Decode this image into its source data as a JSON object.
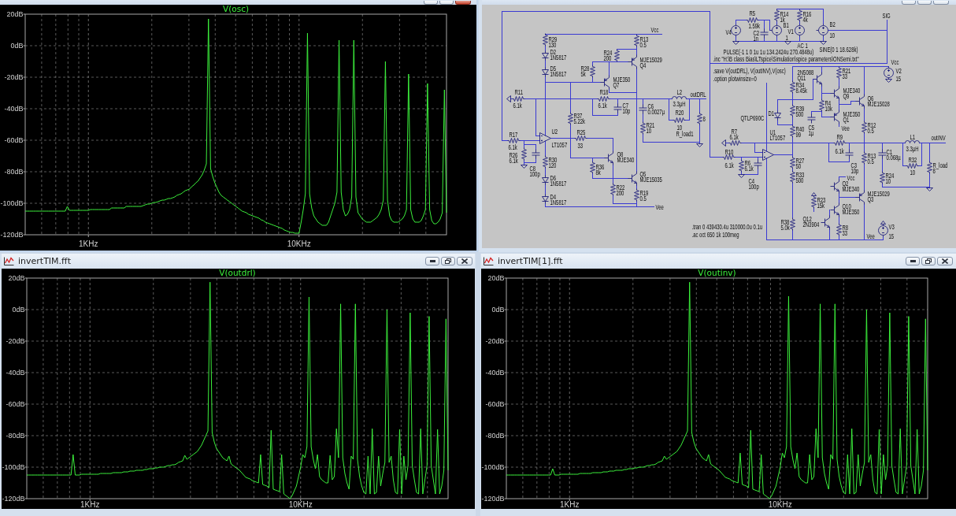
{
  "windows": [
    {
      "kind": "plot",
      "active": true,
      "chart_data": {
        "type": "line",
        "title": "V(osc)",
        "grid": true,
        "categories": [
          null,
          null,
          null,
          null,
          null,
          null,
          null,
          null,
          null,
          null,
          null,
          null,
          null,
          null,
          null,
          null,
          null,
          null,
          null,
          null,
          null,
          null,
          null,
          null,
          null,
          null,
          null,
          null,
          null,
          null,
          "1KHz",
          null,
          null,
          null,
          null,
          null,
          null,
          null,
          null,
          null,
          null,
          null,
          null,
          null,
          null,
          null,
          null,
          null,
          null,
          null,
          null,
          null,
          null,
          null,
          null,
          null,
          null,
          null,
          null,
          null,
          null,
          null,
          null,
          null,
          null,
          null,
          null,
          null,
          null,
          null,
          null,
          null,
          null,
          null,
          null,
          null,
          null,
          null,
          null,
          null,
          null,
          null,
          null,
          null,
          null,
          null,
          null,
          null,
          null,
          null,
          null,
          null,
          null,
          null,
          null,
          null,
          null,
          null,
          null,
          null,
          null,
          null,
          null,
          null,
          null,
          null,
          null,
          null,
          null,
          null,
          null,
          null,
          null,
          null,
          null,
          null,
          null,
          null,
          null,
          null,
          null,
          null,
          null,
          null,
          null,
          null,
          null,
          null,
          null,
          null,
          "10KHz",
          null,
          null,
          null,
          null,
          null,
          null,
          null,
          null,
          null,
          null,
          null,
          null,
          null,
          null,
          null,
          null,
          null,
          null,
          null,
          null,
          null,
          null,
          null,
          null,
          null,
          null,
          null,
          null,
          null,
          null,
          null,
          null,
          null,
          null,
          null,
          null,
          null,
          null,
          null,
          null,
          null,
          null,
          null,
          null,
          null,
          null,
          null,
          null,
          null,
          null,
          null,
          null,
          null,
          null,
          null,
          null,
          null,
          null,
          null,
          null,
          null,
          null,
          null,
          null,
          null,
          null,
          null,
          null,
          null,
          null
        ],
        "series": [
          {
            "color": "#3cf03c",
            "values": [
              -105,
              -105,
              -105,
              -105,
              -105,
              -105,
              -105,
              -105,
              -105,
              -105,
              -105,
              -105,
              -105,
              -105,
              -105,
              -105,
              -105,
              -105,
              -105,
              -105,
              -102,
              -104.5,
              -104.5,
              -104.5,
              -104.5,
              -104.5,
              -104.5,
              -104.5,
              -104.5,
              -104.5,
              -104.5,
              -104,
              -104,
              -104,
              -104,
              -104,
              -104,
              -104,
              -104,
              -104,
              -104,
              -103,
              -103,
              -103,
              -103,
              -103,
              -103,
              -103,
              -102,
              -102,
              -102,
              -102,
              -102,
              -102,
              -102,
              -102,
              -101.5,
              -101,
              -100.5,
              -100.5,
              -100,
              -99.5,
              -99.5,
              -99,
              -98.5,
              -98,
              -98,
              -97.5,
              -97,
              -97,
              -96.5,
              -96,
              -95,
              -94.5,
              -94,
              -93,
              -92,
              -91.5,
              -91,
              -89.5,
              -88.5,
              -87,
              -86,
              -84,
              -82,
              -79,
              -75,
              17,
              -78,
              -83,
              -87,
              -90,
              -93,
              -95,
              -96,
              -97,
              -98,
              -99,
              -100,
              -101,
              -102,
              -103,
              -104,
              -105,
              -105.5,
              -106,
              -107,
              -107.5,
              -108,
              -108.5,
              -109,
              -109.5,
              -110.5,
              -111,
              -112,
              -112.5,
              -113,
              -113.5,
              -114,
              -114.5,
              -115,
              -115.5,
              -116,
              -117,
              -117.5,
              -118,
              -118.5,
              -118.5,
              -119,
              -119,
              -119,
              -112,
              -104,
              -94,
              8,
              -94,
              -103,
              -108,
              -110,
              -112,
              -113,
              -114,
              -114,
              -114,
              -112,
              -108,
              -104,
              -100,
              -93,
              3.5,
              -93,
              -104,
              -108,
              -107,
              -104,
              -96,
              3.5,
              -96,
              -106,
              -108,
              -110,
              -111,
              -112,
              -112,
              -112,
              -111,
              -110,
              -109,
              -107,
              -104,
              -98,
              -10,
              -98,
              -108,
              -111,
              -112,
              -112,
              -112,
              -111,
              -110,
              -108,
              -104,
              -18,
              -104,
              -110,
              -112,
              -112,
              -112,
              -111,
              -108,
              -104,
              -24,
              -104,
              -111,
              -113,
              -113,
              -112,
              -110,
              -106,
              -28,
              -106
            ]
          }
        ],
        "ylim": [
          -120,
          20
        ],
        "yticks": [
          {
            "value": 20,
            "label": "20dB"
          },
          {
            "value": 0,
            "label": "0dB"
          },
          {
            "value": -20,
            "label": "-20dB"
          },
          {
            "value": -40,
            "label": "-40dB"
          },
          {
            "value": -60,
            "label": "-60dB"
          },
          {
            "value": -80,
            "label": "-80dB"
          },
          {
            "value": -100,
            "label": "-100dB"
          },
          {
            "value": -120,
            "label": "-120dB"
          }
        ]
      }
    },
    {
      "kind": "schematic",
      "active": false,
      "schematic": {
        "components": [
          {
            "kind": "resistor",
            "labels": [
              "R29",
              "130"
            ]
          },
          {
            "kind": "resistor",
            "labels": [
              "R13",
              "0.5"
            ]
          },
          {
            "kind": "diode",
            "labels": [
              "D2",
              "1N5817"
            ]
          },
          {
            "kind": "resistor",
            "labels": [
              "R24",
              "200"
            ]
          },
          {
            "kind": "diode",
            "labels": [
              "D5",
              "1N5817"
            ]
          },
          {
            "kind": "resistor",
            "labels": [
              "R28",
              "5k"
            ]
          },
          {
            "kind": "pnp",
            "labels": [
              "MJE15029",
              "Q4"
            ]
          },
          {
            "kind": "pnp",
            "labels": [
              "MJE350",
              "Q7"
            ]
          },
          {
            "kind": "resistor",
            "labels": [
              "R11",
              "6.1k"
            ]
          },
          {
            "kind": "resistor",
            "labels": [
              "R18",
              "6.1k"
            ]
          },
          {
            "kind": "resistor",
            "labels": [
              "R37",
              "5.22k"
            ]
          },
          {
            "kind": "capacitor",
            "labels": [
              "C7",
              "10p"
            ]
          },
          {
            "kind": "capacitor",
            "labels": [
              "C6",
              "0.0027µ"
            ]
          },
          {
            "kind": "inductor",
            "labels": [
              "L2",
              "3.3µH"
            ]
          },
          {
            "kind": "resistor",
            "labels": [
              "R17",
              "6.1k"
            ]
          },
          {
            "kind": "opamp",
            "labels": [
              "U2",
              "LT1057"
            ]
          },
          {
            "kind": "resistor",
            "labels": [
              "R25",
              "33"
            ]
          },
          {
            "kind": "resistor",
            "labels": [
              "R21",
              "10"
            ]
          },
          {
            "kind": "resistor",
            "labels": [
              "R20",
              "10"
            ]
          },
          {
            "kind": "resistor",
            "labels": [
              "R_load1",
              "8"
            ]
          },
          {
            "kind": "resistor",
            "labels": [
              "R26",
              "6.1k"
            ]
          },
          {
            "kind": "capacitor",
            "labels": [
              "C8",
              "100p"
            ]
          },
          {
            "kind": "resistor",
            "labels": [
              "R30",
              "120"
            ]
          },
          {
            "kind": "npn",
            "labels": [
              "Q8",
              "MJE340"
            ]
          },
          {
            "kind": "diode",
            "labels": [
              "D6",
              "1N5817"
            ]
          },
          {
            "kind": "resistor",
            "labels": [
              "R36",
              "8k"
            ]
          },
          {
            "kind": "npn",
            "labels": [
              "Q5",
              "MJE15035"
            ]
          },
          {
            "kind": "diode",
            "labels": [
              "D4",
              "1N5817"
            ]
          },
          {
            "kind": "resistor",
            "labels": [
              "R22",
              "200"
            ]
          },
          {
            "kind": "resistor",
            "labels": [
              "R19",
              "0.5"
            ]
          },
          {
            "kind": "resistor",
            "labels": [
              "R5",
              "1.59k"
            ]
          },
          {
            "kind": "resistor",
            "labels": [
              "R14",
              "1k"
            ]
          },
          {
            "kind": "resistor",
            "labels": [
              "R16",
              "4k"
            ]
          },
          {
            "kind": "vsource",
            "labels": [
              "V4"
            ]
          },
          {
            "kind": "capacitor",
            "labels": [
              "C2",
              "1n"
            ]
          },
          {
            "kind": "bsource",
            "labels": [
              "B1"
            ]
          },
          {
            "kind": "vsource",
            "labels": [
              "V1"
            ]
          },
          {
            "kind": "bsource",
            "labels": [
              "B2",
              "10"
            ]
          },
          {
            "kind": "npn",
            "labels": [
              "2N5088",
              "Q11"
            ]
          },
          {
            "kind": "resistor",
            "labels": [
              "R21",
              "33"
            ]
          },
          {
            "kind": "vsource",
            "labels": [
              "V2",
              "15"
            ]
          },
          {
            "kind": "resistor",
            "labels": [
              "R34",
              "8.45k"
            ]
          },
          {
            "kind": "npn",
            "labels": [
              "MJE340",
              "Q9"
            ]
          },
          {
            "kind": "diode",
            "labels": [
              "D1",
              "QTLP690C"
            ]
          },
          {
            "kind": "resistor",
            "labels": [
              "R39",
              "500"
            ]
          },
          {
            "kind": "resistor",
            "labels": [
              "R4",
              "10k"
            ]
          },
          {
            "kind": "npn",
            "labels": [
              "Q6",
              "MJE15028"
            ]
          },
          {
            "kind": "pnp",
            "labels": [
              "MJE350",
              "Q1"
            ]
          },
          {
            "kind": "resistor",
            "labels": [
              "R7",
              "6.1k"
            ]
          },
          {
            "kind": "opamp",
            "labels": [
              "U1",
              "LT1057"
            ]
          },
          {
            "kind": "resistor",
            "labels": [
              "R40",
              "99"
            ]
          },
          {
            "kind": "capacitor",
            "labels": [
              "C5",
              "1µ"
            ]
          },
          {
            "kind": "resistor",
            "labels": [
              "R12",
              "0.5"
            ]
          },
          {
            "kind": "resistor",
            "labels": [
              "R10",
              "6.1k"
            ]
          },
          {
            "kind": "resistor",
            "labels": [
              "R9",
              "6.1k"
            ]
          },
          {
            "kind": "resistor",
            "labels": [
              "R6",
              "6.1k"
            ]
          },
          {
            "kind": "resistor",
            "labels": [
              "R27",
              "50"
            ]
          },
          {
            "kind": "capacitor",
            "labels": [
              "C4",
              "100p"
            ]
          },
          {
            "kind": "resistor",
            "labels": [
              "R33",
              "500"
            ]
          },
          {
            "kind": "capacitor",
            "labels": [
              "C3",
              "10p"
            ]
          },
          {
            "kind": "resistor",
            "labels": [
              "R13",
              "0.5"
            ]
          },
          {
            "kind": "capacitor",
            "labels": [
              "C1",
              "0.068µ"
            ]
          },
          {
            "kind": "inductor",
            "labels": [
              "L1",
              "3.3µH"
            ]
          },
          {
            "kind": "npn",
            "labels": [
              "Q2",
              "MJE340"
            ]
          },
          {
            "kind": "resistor",
            "labels": [
              "R24",
              "10"
            ]
          },
          {
            "kind": "resistor",
            "labels": [
              "R32",
              "10"
            ]
          },
          {
            "kind": "resistor",
            "labels": [
              "R_load",
              "8"
            ]
          },
          {
            "kind": "resistor",
            "labels": [
              "R23",
              "15k"
            ]
          },
          {
            "kind": "pnp",
            "labels": [
              "MJE15029",
              "Q3"
            ]
          },
          {
            "kind": "npn",
            "labels": [
              "Q10",
              "MJE350"
            ]
          },
          {
            "kind": "resistor",
            "labels": [
              "R38",
              "5.0k"
            ]
          },
          {
            "kind": "npn",
            "labels": [
              "Q12",
              "2N3904"
            ]
          },
          {
            "kind": "resistor",
            "labels": [
              "R8",
              "33"
            ]
          },
          {
            "kind": "vsource",
            "labels": [
              "V3",
              "15"
            ]
          }
        ],
        "net_labels": [
          "Vcc",
          "outDRL",
          "Vee",
          "SIG",
          "1",
          "AC 1",
          "Vcc",
          "Vee",
          "outINV",
          "Vcc",
          "Vee"
        ],
        "source_values": [
          "PULSE(-1 1 0 1u 1u 134.2424u 270.4848u)",
          "SINE(0 1 18.628k)"
        ],
        "directives": [
          ".inc \"H:\\B class Bias\\LTspice\\Simulation\\spice parameters\\ONSemi.txt\"",
          ".save V(outDRL), V(outINV),V(osc)",
          ".option plotwinsize=0",
          ".tran 0 439430.4u 310000.0u 0.1u",
          ".ac oct 650 1k 100meg"
        ]
      }
    },
    {
      "kind": "plot",
      "title": "invertTIM.fft",
      "active": false,
      "chart_data": {
        "type": "line",
        "title": "V(outdrl)",
        "grid": true,
        "categories": [
          null,
          null,
          null,
          null,
          null,
          null,
          null,
          null,
          null,
          null,
          null,
          null,
          null,
          null,
          null,
          null,
          null,
          null,
          null,
          null,
          null,
          null,
          null,
          null,
          null,
          null,
          null,
          null,
          null,
          null,
          "1KHz",
          null,
          null,
          null,
          null,
          null,
          null,
          null,
          null,
          null,
          null,
          null,
          null,
          null,
          null,
          null,
          null,
          null,
          null,
          null,
          null,
          null,
          null,
          null,
          null,
          null,
          null,
          null,
          null,
          null,
          null,
          null,
          null,
          null,
          null,
          null,
          null,
          null,
          null,
          null,
          null,
          null,
          null,
          null,
          null,
          null,
          null,
          null,
          null,
          null,
          null,
          null,
          null,
          null,
          null,
          null,
          null,
          null,
          null,
          null,
          null,
          null,
          null,
          null,
          null,
          null,
          null,
          null,
          null,
          null,
          null,
          null,
          null,
          null,
          null,
          null,
          null,
          null,
          null,
          null,
          null,
          null,
          null,
          null,
          null,
          null,
          null,
          null,
          null,
          null,
          null,
          null,
          null,
          null,
          null,
          null,
          null,
          null,
          null,
          null,
          "10KHz",
          null,
          null,
          null,
          null,
          null,
          null,
          null,
          null,
          null,
          null,
          null,
          null,
          null,
          null,
          null,
          null,
          null,
          null,
          null,
          null,
          null,
          null,
          null,
          null,
          null,
          null,
          null,
          null,
          null,
          null,
          null,
          null,
          null,
          null,
          null,
          null,
          null,
          null,
          null,
          null,
          null,
          null,
          null,
          null,
          null,
          null,
          null,
          null,
          null,
          null,
          null,
          null,
          null,
          null,
          null,
          null,
          null,
          null,
          null,
          null,
          null,
          null,
          null,
          null,
          null,
          null,
          null,
          null,
          null,
          null
        ],
        "series": [
          {
            "color": "#3cf03c",
            "values": [
              -105,
              -105,
              -105,
              -105,
              -105,
              -105,
              -105,
              -105,
              -105,
              -105,
              -105,
              -105,
              -105,
              -105,
              -105,
              -105,
              -105,
              -105,
              -105,
              -105,
              -105,
              -105,
              -92,
              -105,
              -105,
              -105,
              -104.5,
              -104.5,
              -104.5,
              -104.5,
              -104.5,
              -104.5,
              -104.5,
              -104.5,
              -104.5,
              -104,
              -104,
              -104,
              -104,
              -104,
              -104,
              -103.5,
              -103.5,
              -103.5,
              -103.5,
              -103.5,
              -103,
              -103,
              -103,
              -102.5,
              -102.5,
              -102.5,
              -102,
              -102,
              -102,
              -102,
              -101.5,
              -101.5,
              -101,
              -101,
              -101,
              -100.5,
              -100.5,
              -100,
              -100,
              -100,
              -99.5,
              -99,
              -99,
              -98.5,
              -98.5,
              -98,
              -97,
              -96.5,
              -96,
              -92.5,
              -95,
              -94,
              -93,
              -92,
              -91,
              -90,
              -88,
              -86,
              -83,
              -80,
              -77,
              17.4,
              -78,
              -84,
              -88,
              -90,
              -92,
              -94,
              -95,
              -96,
              -93,
              -98,
              -99,
              -100,
              -101,
              -102,
              -103.5,
              -105,
              -106.5,
              -107,
              -107.5,
              -108.5,
              -109,
              -109.5,
              -110,
              -92,
              -111,
              -111.5,
              -112,
              -113,
              -76.6,
              -114,
              -114.5,
              -115,
              -115.5,
              -92,
              -117,
              -118,
              -119,
              -120,
              -118,
              -115,
              -112,
              -106,
              -100,
              -92,
              -94,
              -87,
              8,
              -87,
              -95,
              -101,
              -92,
              -106,
              -108,
              -109,
              -110,
              -110,
              -92.5,
              -108,
              -106,
              -75.6,
              -94,
              3.6,
              -94,
              -104,
              -110,
              -114,
              -93,
              -95,
              3.6,
              -95,
              -106,
              -112,
              -116,
              -117,
              -93,
              -117,
              -75.6,
              -117,
              -116,
              -93,
              -112,
              -104,
              -97,
              0,
              -97,
              -93,
              -108,
              -116,
              -117,
              -76,
              -117,
              -93,
              -108,
              -99,
              -2,
              -99,
              -108,
              -116,
              -117,
              -75.6,
              -117,
              -108,
              -99,
              -4.3,
              -99,
              -108,
              -117,
              -76,
              -117,
              -112,
              -102,
              -5.9,
              -102
            ]
          }
        ],
        "ylim": [
          -120,
          20
        ],
        "yticks": [
          {
            "value": 20,
            "label": "20dB"
          },
          {
            "value": 0,
            "label": "0dB"
          },
          {
            "value": -20,
            "label": "-20dB"
          },
          {
            "value": -40,
            "label": "-40dB"
          },
          {
            "value": -60,
            "label": "-60dB"
          },
          {
            "value": -80,
            "label": "-80dB"
          },
          {
            "value": -100,
            "label": "-100dB"
          },
          {
            "value": -120,
            "label": "-120dB"
          }
        ]
      }
    },
    {
      "kind": "plot",
      "title": "invertTIM[1].fft",
      "active": false,
      "chart_data": {
        "type": "line",
        "title": "V(outinv)",
        "grid": true,
        "categories": [
          null,
          null,
          null,
          null,
          null,
          null,
          null,
          null,
          null,
          null,
          null,
          null,
          null,
          null,
          null,
          null,
          null,
          null,
          null,
          null,
          null,
          null,
          null,
          null,
          null,
          null,
          null,
          null,
          null,
          null,
          "1KHz",
          null,
          null,
          null,
          null,
          null,
          null,
          null,
          null,
          null,
          null,
          null,
          null,
          null,
          null,
          null,
          null,
          null,
          null,
          null,
          null,
          null,
          null,
          null,
          null,
          null,
          null,
          null,
          null,
          null,
          null,
          null,
          null,
          null,
          null,
          null,
          null,
          null,
          null,
          null,
          null,
          null,
          null,
          null,
          null,
          null,
          null,
          null,
          null,
          null,
          null,
          null,
          null,
          null,
          null,
          null,
          null,
          null,
          null,
          null,
          null,
          null,
          null,
          null,
          null,
          null,
          null,
          null,
          null,
          null,
          null,
          null,
          null,
          null,
          null,
          null,
          null,
          null,
          null,
          null,
          null,
          null,
          null,
          null,
          null,
          null,
          null,
          null,
          null,
          null,
          null,
          null,
          null,
          null,
          null,
          null,
          null,
          null,
          null,
          null,
          "10KHz",
          null,
          null,
          null,
          null,
          null,
          null,
          null,
          null,
          null,
          null,
          null,
          null,
          null,
          null,
          null,
          null,
          null,
          null,
          null,
          null,
          null,
          null,
          null,
          null,
          null,
          null,
          null,
          null,
          null,
          null,
          null,
          null,
          null,
          null,
          null,
          null,
          null,
          null,
          null,
          null,
          null,
          null,
          null,
          null,
          null,
          null,
          null,
          null,
          null,
          null,
          null,
          null,
          null,
          null,
          null,
          null,
          null,
          null,
          null,
          null,
          null,
          null,
          null,
          null,
          null,
          null,
          null,
          null,
          null,
          null
        ],
        "series": [
          {
            "color": "#3cf03c",
            "values": [
              -105,
              -105,
              -105,
              -105,
              -105,
              -105,
              -105,
              -105,
              -105,
              -105,
              -105,
              -105,
              -105,
              -105,
              -105,
              -105,
              -105,
              -105,
              -105,
              -105,
              -105,
              -105,
              -101,
              -105,
              -105,
              -105,
              -104.5,
              -104.5,
              -104.5,
              -104.5,
              -104.5,
              -104.5,
              -104.5,
              -104.5,
              -104.5,
              -104,
              -104,
              -104,
              -104,
              -104,
              -104,
              -103.5,
              -103.5,
              -103.5,
              -103.5,
              -103.5,
              -103,
              -103,
              -103,
              -102.5,
              -102.5,
              -102.5,
              -102,
              -102,
              -102,
              -102,
              -101.5,
              -101.5,
              -101,
              -101,
              -101,
              -100.5,
              -100.5,
              -100,
              -100,
              -100,
              -99.5,
              -99,
              -99,
              -98.5,
              -98.5,
              -98,
              -97,
              -96.5,
              -96,
              -93,
              -95,
              -94,
              -93,
              -92,
              -91,
              -90,
              -88,
              -86,
              -83,
              -80,
              -77,
              17.4,
              -78,
              -84,
              -88,
              -90,
              -92,
              -94,
              -95,
              -96,
              -92,
              -98,
              -99,
              -100,
              -101,
              -102,
              -103.5,
              -105,
              -106.5,
              -107,
              -107.5,
              -108.5,
              -109,
              -109.5,
              -110,
              -91,
              -111,
              -111.5,
              -112,
              -113,
              -76.6,
              -114,
              -114.5,
              -115,
              -115.5,
              -92,
              -117,
              -118,
              -119,
              -120,
              -118,
              -115,
              -112,
              -106,
              -100,
              -91,
              -94,
              -87,
              8.5,
              -87,
              -95,
              -101,
              -91,
              -106,
              -108,
              -109,
              -110,
              -110,
              -92,
              -108,
              -106,
              -75.6,
              -94,
              3.6,
              -94,
              -104,
              -110,
              -114,
              -92,
              -95,
              3.6,
              -95,
              -106,
              -112,
              -116,
              -117,
              -92,
              -117,
              -75.6,
              -117,
              -116,
              -92,
              -112,
              -104,
              -97,
              0,
              -97,
              -92,
              -108,
              -116,
              -117,
              -76,
              -117,
              -92,
              -108,
              -99,
              -2,
              -99,
              -108,
              -116,
              -117,
              -75.6,
              -117,
              -108,
              -99,
              -4.3,
              -99,
              -108,
              -117,
              -76,
              -117,
              -112,
              -102,
              -5.9,
              -102
            ]
          }
        ],
        "ylim": [
          -120,
          20
        ],
        "yticks": [
          {
            "value": 20,
            "label": "20dB"
          },
          {
            "value": 0,
            "label": "0dB"
          },
          {
            "value": -20,
            "label": "-20dB"
          },
          {
            "value": -40,
            "label": "-40dB"
          },
          {
            "value": -60,
            "label": "-60dB"
          },
          {
            "value": -80,
            "label": "-80dB"
          },
          {
            "value": -100,
            "label": "-100dB"
          },
          {
            "value": -120,
            "label": "-120dB"
          }
        ]
      }
    }
  ]
}
